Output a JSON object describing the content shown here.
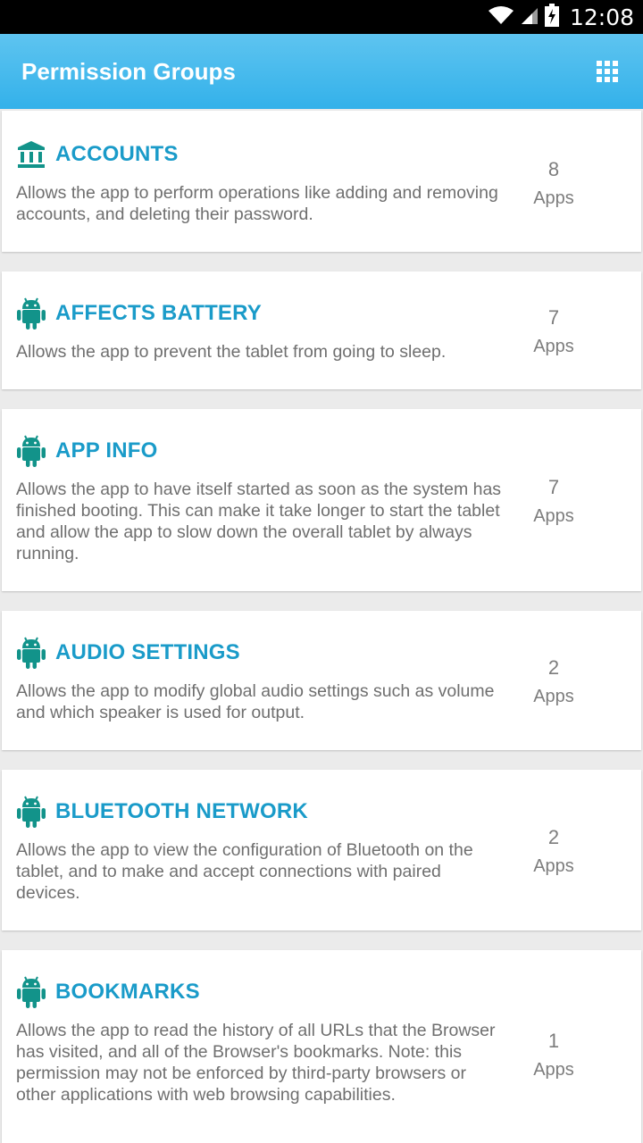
{
  "status_bar": {
    "time": "12:08"
  },
  "app_bar": {
    "title": "Permission Groups"
  },
  "groups": [
    {
      "title": "ACCOUNTS",
      "icon": "bank-icon",
      "description": "Allows the app to perform operations like adding and removing accounts, and deleting their password.",
      "count": "8",
      "count_label": "Apps"
    },
    {
      "title": "AFFECTS BATTERY",
      "icon": "android-icon",
      "description": "Allows the app to prevent the tablet from going to sleep.",
      "count": "7",
      "count_label": "Apps"
    },
    {
      "title": "APP INFO",
      "icon": "android-icon",
      "description": "Allows the app to have itself started as soon as the system has finished booting. This can make it take longer to start the tablet and allow the app to slow down the overall tablet by always running.",
      "count": "7",
      "count_label": "Apps"
    },
    {
      "title": "AUDIO SETTINGS",
      "icon": "android-icon",
      "description": "Allows the app to modify global audio settings such as volume and which speaker is used for output.",
      "count": "2",
      "count_label": "Apps"
    },
    {
      "title": "BLUETOOTH NETWORK",
      "icon": "android-icon",
      "description": "Allows the app to view the configuration of Bluetooth on the tablet, and to make and accept connections with paired devices.",
      "count": "2",
      "count_label": "Apps"
    },
    {
      "title": "BOOKMARKS",
      "icon": "android-icon",
      "description": "Allows the app to read the history of all URLs that the Browser has visited, and all of the Browser's bookmarks. Note: this permission may not be enforced by third-party browsers or other applications with web browsing capabilities.",
      "count": "1",
      "count_label": "Apps"
    }
  ],
  "colors": {
    "accent": "#1a9bc9",
    "icon": "#12938a",
    "app_bar": "#33b1ea"
  }
}
